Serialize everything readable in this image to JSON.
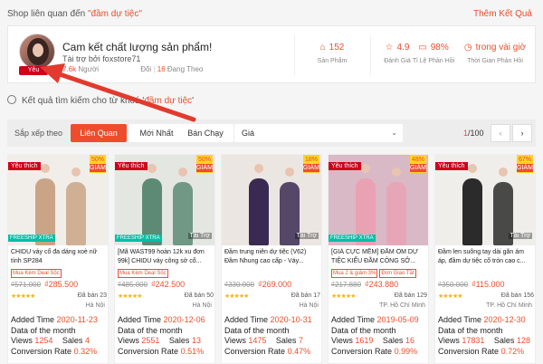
{
  "header": {
    "related_prefix": "Shop liên quan đến ",
    "related_keyword": "\"đầm dự tiệc\"",
    "more_shops": "Thêm Kết Quả"
  },
  "shop": {
    "badge": "Yêu Thích+",
    "name": "Cam kết chất lượng sản phẩm!",
    "sponsor": "Tài trợ bởi foxstore71",
    "followers_value": "7.6k",
    "followers_label": "Người",
    "following_label": "Đõi",
    "following_value": "16",
    "following_suffix": "Đang Theo",
    "metrics": [
      {
        "icon": "shop-products-icon",
        "value": "152",
        "label": "Sản Phẩm"
      },
      {
        "icon": "star-icon",
        "value": "4.9",
        "label": "Đánh Giá"
      },
      {
        "icon": "chat-icon",
        "value": "98%",
        "label": "Tỉ Lệ Phản Hồi"
      },
      {
        "icon": "clock-icon",
        "value": "trong vài giờ",
        "label": "Thời Gian Phản Hồi"
      }
    ]
  },
  "notice": {
    "prefix": "Kết quả tìm kiếm cho từ khoá '",
    "keyword": "đầm dự tiệc",
    "suffix": "'"
  },
  "sort": {
    "label": "Sắp xếp theo",
    "options": [
      "Liên Quan",
      "Mới Nhất",
      "Bán Chạy"
    ],
    "price_select": "Giá",
    "page_current": "1",
    "page_total": "/100",
    "prev": "‹",
    "next": "›"
  },
  "labels": {
    "added_time": "Added Time",
    "data_of_month": "Data of the month",
    "views": "Views",
    "sales": "Sales",
    "conversion": "Conversion Rate",
    "ad": "Tài Trợ",
    "fav": "Yêu thích",
    "freeship": "FREESHIP XTRA"
  },
  "products": [
    {
      "fav": true,
      "discount": "50%",
      "disc_label": "GIẢM",
      "ad": false,
      "freeship": true,
      "title": "CHIDU váy cổ đa dáng xoè nữ tính SP284",
      "tags": [
        "Mua Kèm Deal Sốc"
      ],
      "old_price": "₫571.000",
      "new_price": "₫285.500",
      "stars": "★★★★★",
      "sold": "Đã bán 23",
      "location": "Hà Nội",
      "added": "2020-11-23",
      "views": "1254",
      "sales": "4",
      "conv": "0.32%",
      "bg": "#f1ede8",
      "dress": "#c9a486"
    },
    {
      "fav": true,
      "discount": "50%",
      "disc_label": "GIẢM",
      "ad": true,
      "freeship": true,
      "title": "[Mã WAST99 hoàn 12k xu đơn 99k] CHIDU váy công sở cổ...",
      "tags": [
        "Mua Kèm Deal Sốc"
      ],
      "old_price": "₫485.000",
      "new_price": "₫242.500",
      "stars": "★★★★★",
      "sold": "Đã bán 50",
      "location": "Hà Nội",
      "added": "2020-12-06",
      "views": "2551",
      "sales": "13",
      "conv": "0.51%",
      "bg": "#e4e6e1",
      "dress": "#5c8a74"
    },
    {
      "fav": false,
      "discount": "18%",
      "disc_label": "GIẢM",
      "ad": true,
      "freeship": false,
      "title": "Đầm trung niên dự tiệc (V62) Đầm Nhung cao cấp - Váy...",
      "tags": [],
      "old_price": "₫330.000",
      "new_price": "₫269.000",
      "stars": "★★★★★",
      "sold": "Đã bán 17",
      "location": "Hà Nội",
      "added": "2020-10-31",
      "views": "1475",
      "sales": "7",
      "conv": "0.47%",
      "bg": "#ece6e2",
      "dress": "#3a2a52"
    },
    {
      "fav": true,
      "discount": "48%",
      "disc_label": "GIẢM",
      "ad": false,
      "freeship": true,
      "title": "[GIÁ CỰC MỀM] ĐẦM ÔM DỰ TIỆC KIỂU ĐẦM CÔNG SỞ...",
      "tags": [
        "Mua 2 & giảm 3%",
        "Đơn Giao Tắt"
      ],
      "old_price": "₫217.880",
      "new_price": "₫243.880",
      "stars": "★★★★★",
      "sold": "Đã bán 129",
      "location": "TP. Hồ Chí Minh",
      "added": "2019-05-09",
      "views": "1619",
      "sales": "16",
      "conv": "0.99%",
      "bg": "#d9b9c6",
      "dress": "#e9a2b4"
    },
    {
      "fav": true,
      "discount": "67%",
      "disc_label": "GIẢM",
      "ad": true,
      "freeship": false,
      "title": "Đầm len suông tay dài gắn ám áp, đầm dự tiệc cổ tròn cao c...",
      "tags": [],
      "old_price": "₫350.000",
      "new_price": "₫115.000",
      "stars": "★★★★★",
      "sold": "Đã bán 156",
      "location": "TP. Hồ Chí Minh",
      "added": "2020-12-30",
      "views": "17831",
      "sales": "128",
      "conv": "0.72%",
      "bg": "#efeeeb",
      "dress": "#2b2b2b"
    }
  ],
  "colors": {
    "accent": "#ee4d2d",
    "arrow": "#e23a2e"
  }
}
